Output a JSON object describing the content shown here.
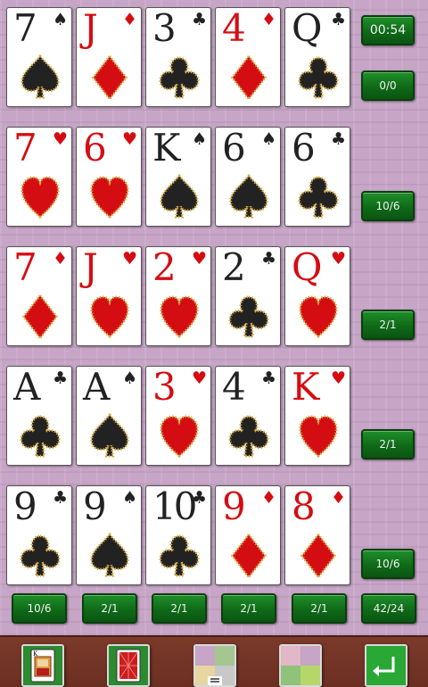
{
  "status": {
    "timer": "00:54",
    "score": "0/0"
  },
  "tableau": [
    [
      {
        "rank": "7",
        "suit": "spade"
      },
      {
        "rank": "J",
        "suit": "diamond"
      },
      {
        "rank": "3",
        "suit": "club"
      },
      {
        "rank": "4",
        "suit": "diamond"
      },
      {
        "rank": "Q",
        "suit": "club"
      }
    ],
    [
      {
        "rank": "7",
        "suit": "heart"
      },
      {
        "rank": "6",
        "suit": "heart"
      },
      {
        "rank": "K",
        "suit": "spade"
      },
      {
        "rank": "6",
        "suit": "spade"
      },
      {
        "rank": "6",
        "suit": "club"
      }
    ],
    [
      {
        "rank": "7",
        "suit": "diamond"
      },
      {
        "rank": "J",
        "suit": "heart"
      },
      {
        "rank": "2",
        "suit": "heart"
      },
      {
        "rank": "2",
        "suit": "club"
      },
      {
        "rank": "Q",
        "suit": "heart"
      }
    ],
    [
      {
        "rank": "A",
        "suit": "club"
      },
      {
        "rank": "A",
        "suit": "spade"
      },
      {
        "rank": "3",
        "suit": "heart"
      },
      {
        "rank": "4",
        "suit": "club"
      },
      {
        "rank": "K",
        "suit": "heart"
      }
    ],
    [
      {
        "rank": "9",
        "suit": "club"
      },
      {
        "rank": "9",
        "suit": "spade"
      },
      {
        "rank": "10",
        "suit": "club"
      },
      {
        "rank": "9",
        "suit": "diamond"
      },
      {
        "rank": "8",
        "suit": "diamond"
      }
    ]
  ],
  "row_scores": [
    "10/6",
    "2/1",
    "2/1",
    "10/6"
  ],
  "column_scores": [
    "10/6",
    "2/1",
    "2/1",
    "2/1",
    "2/1"
  ],
  "total_score": "42/24",
  "toolbar": [
    {
      "name": "new-game-button",
      "icon": "card-king-icon"
    },
    {
      "name": "card-back-button",
      "icon": "card-back-icon"
    },
    {
      "name": "menu-button",
      "icon": "menu-lines-icon"
    },
    {
      "name": "background-button",
      "icon": "background-tiles-icon"
    },
    {
      "name": "undo-button",
      "icon": "undo-arrow-icon"
    }
  ],
  "colors": {
    "red_suit": "#d40d12",
    "black_suit": "#222222",
    "button_green": "#0f6a18",
    "table": "#c6a5c6",
    "bar": "#6b2f22"
  }
}
